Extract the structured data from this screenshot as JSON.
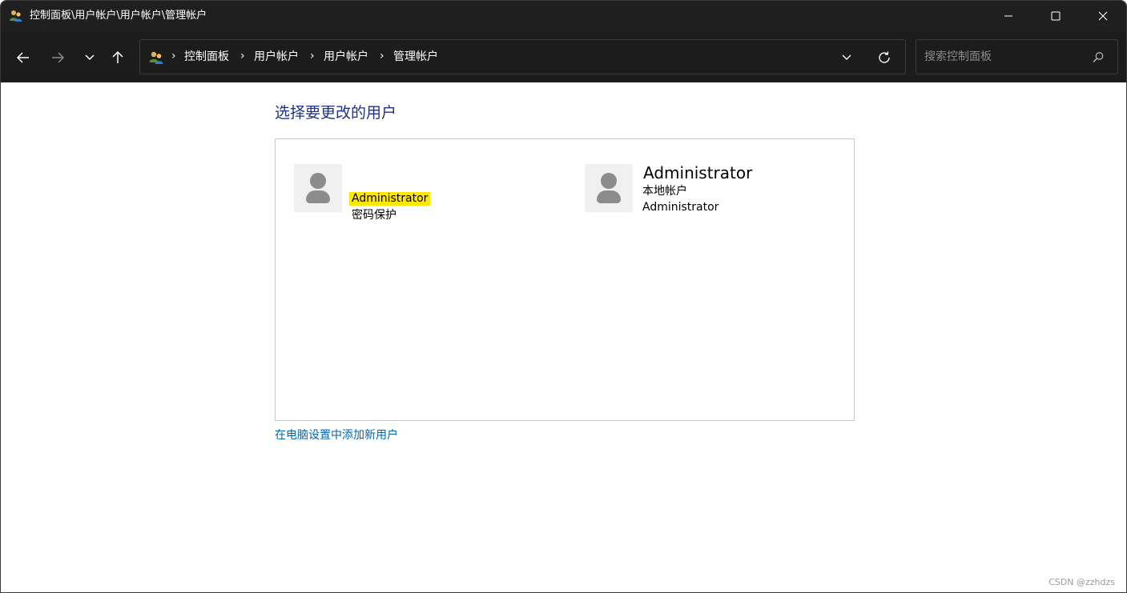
{
  "window": {
    "title": "控制面板\\用户帐户\\用户帐户\\管理帐户",
    "icon": "users-icon"
  },
  "titlebar_buttons": {
    "minimize": "minimize-icon",
    "maximize": "maximize-icon",
    "close": "close-icon"
  },
  "nav": {
    "back": "back-arrow-icon",
    "forward": "forward-arrow-icon",
    "recent": "chevron-down-icon",
    "up": "up-arrow-icon"
  },
  "address": {
    "icon": "users-icon",
    "crumbs": [
      "控制面板",
      "用户帐户",
      "用户帐户",
      "管理帐户"
    ],
    "separator": "›"
  },
  "search": {
    "placeholder": "搜索控制面板",
    "value": ""
  },
  "main": {
    "title": "选择要更改的用户",
    "users": [
      {
        "name": "Administrator",
        "desc": "密码保护",
        "highlighted": true
      },
      {
        "name": "Administrator",
        "type": "本地帐户",
        "role": "Administrator",
        "highlighted": false
      }
    ],
    "add_user_link": "在电脑设置中添加新用户"
  },
  "watermark": "CSDN @zzhdzs",
  "colors": {
    "titlebar_bg": "#1f1f1f",
    "navbar_bg": "#1c1c1c",
    "title_blue": "#1e3287",
    "link_blue": "#0066b4",
    "highlight": "#ffe800",
    "avatar_gray": "#8c8c8c"
  }
}
